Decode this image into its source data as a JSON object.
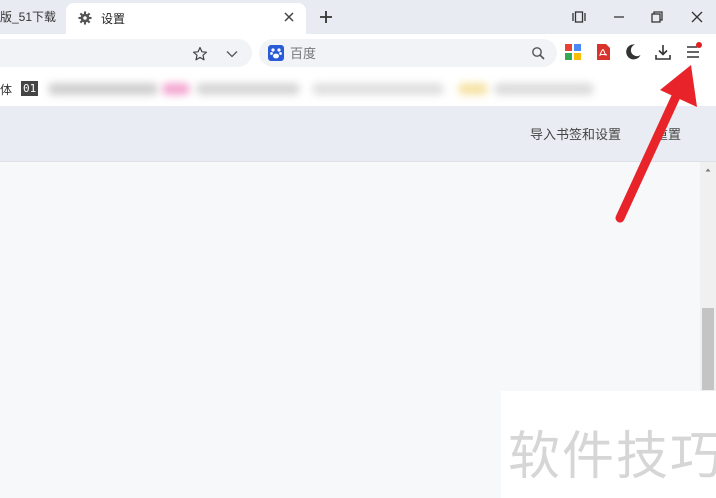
{
  "tabs": [
    {
      "label": "版_51下载",
      "active": false
    },
    {
      "label": "设置",
      "active": true
    }
  ],
  "search": {
    "placeholder": "百度"
  },
  "bookmarks": {
    "partial_label": "体",
    "box_label": "01",
    "more": "»"
  },
  "settings": {
    "import_link": "导入书签和设置",
    "reset_link": "重置"
  },
  "watermark": "软件技巧",
  "colors": {
    "accent_red": "#e02020",
    "annotation_arrow": "#e8232a",
    "header_bg": "#e9ecf2"
  },
  "icons": [
    "gear-icon",
    "close-icon",
    "plus-icon",
    "tab-strip-icon",
    "minimize-icon",
    "restore-icon",
    "window-close-icon",
    "star-icon",
    "chevron-down-icon",
    "baidu-paw-icon",
    "search-icon",
    "apps-icon",
    "pdf-icon",
    "moon-icon",
    "download-icon",
    "menu-icon"
  ]
}
